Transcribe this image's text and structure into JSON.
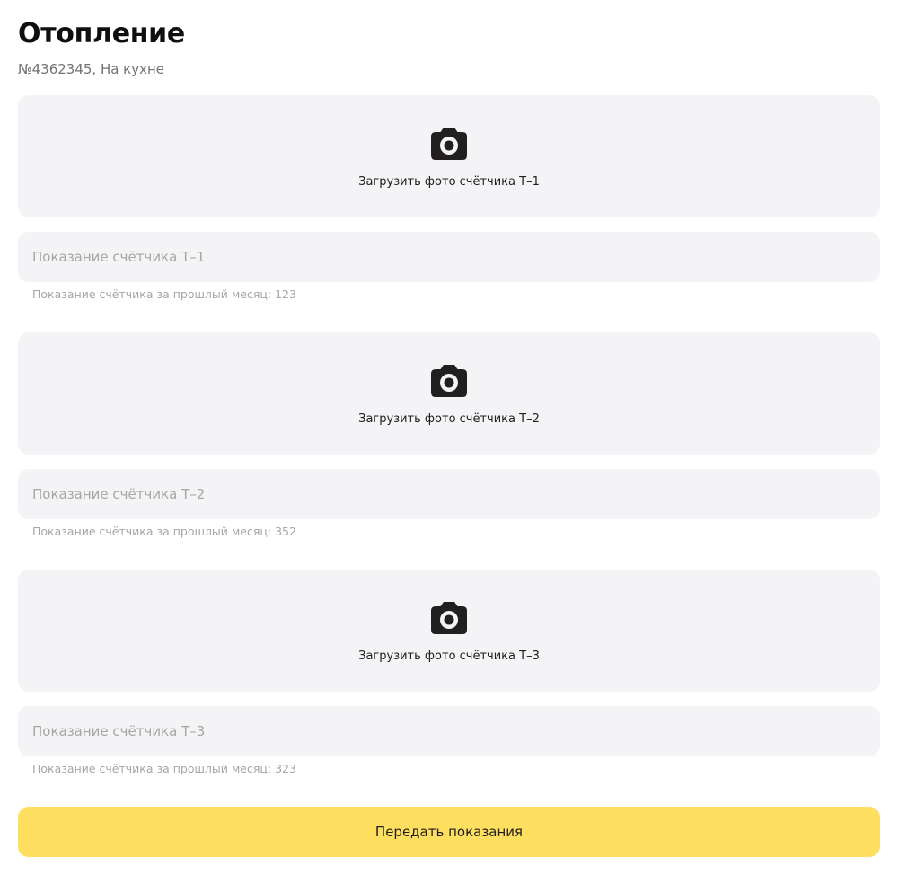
{
  "header": {
    "title": "Отопление",
    "subtitle": "№4362345, На кухне"
  },
  "meters": [
    {
      "upload_icon": "camera-icon",
      "upload_label": "Загрузить фото счётчика Т–1",
      "input_value": "",
      "input_placeholder": "Показание счётчика Т–1",
      "previous_hint": "Показание счётчика за прошлый месяц: 123"
    },
    {
      "upload_icon": "camera-icon",
      "upload_label": "Загрузить фото счётчика Т–2",
      "input_value": "",
      "input_placeholder": "Показание счётчика Т–2",
      "previous_hint": "Показание счётчика за прошлый месяц: 352"
    },
    {
      "upload_icon": "camera-icon",
      "upload_label": "Загрузить фото счётчика Т–3",
      "input_value": "",
      "input_placeholder": "Показание счётчика Т–3",
      "previous_hint": "Показание счётчика за прошлый месяц: 323"
    }
  ],
  "submit_label": "Передать показания",
  "colors": {
    "accent": "#fedf5f",
    "field_background": "#f4f4f6",
    "muted_text": "#a8a6a3",
    "subtitle_text": "#75736f",
    "icon": "#21201f"
  }
}
